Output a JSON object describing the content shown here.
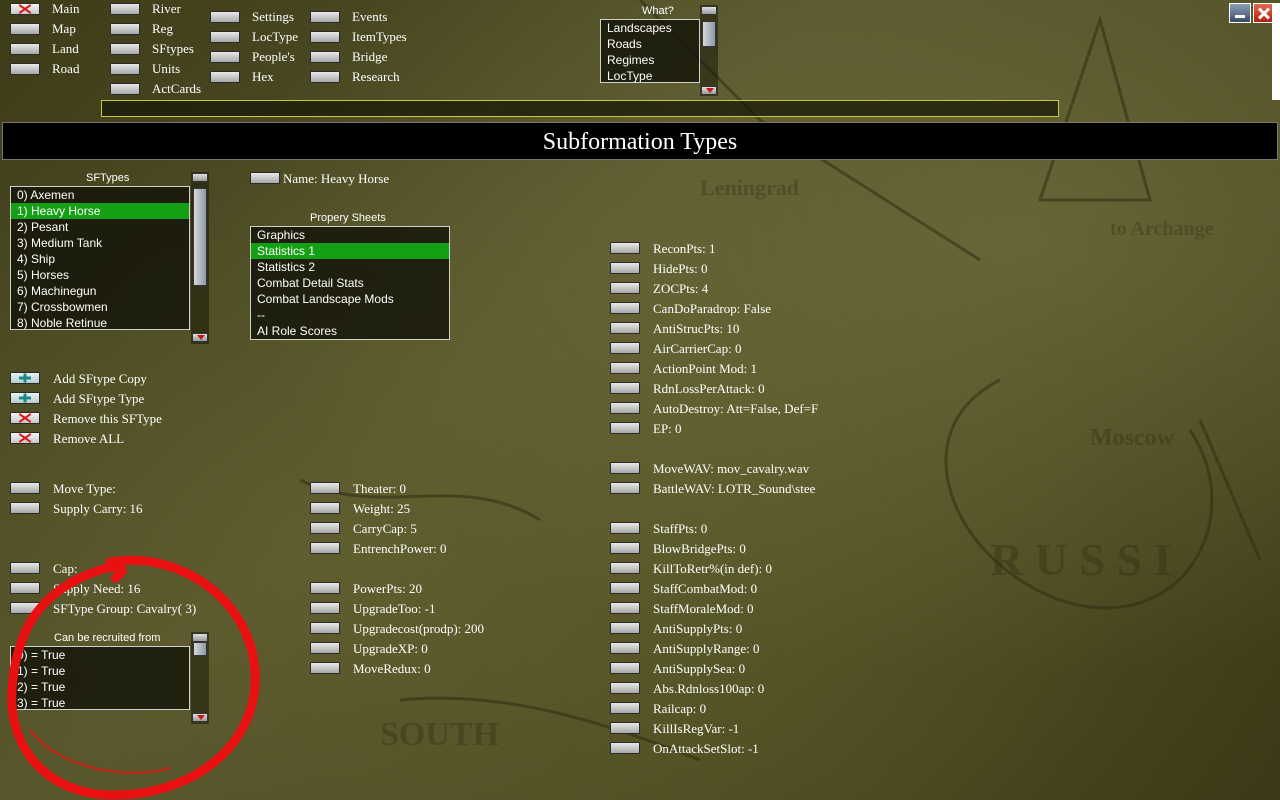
{
  "top_nav": {
    "col1": [
      "Main",
      "Map",
      "Land",
      "Road"
    ],
    "col2": [
      "River",
      "Reg",
      "SFtypes",
      "Units",
      "ActCards"
    ],
    "col3": [
      "Settings",
      "LocType",
      "People's",
      "Hex"
    ],
    "col4": [
      "Events",
      "ItemTypes",
      "Bridge",
      "Research"
    ]
  },
  "what": {
    "label": "What?",
    "items": [
      "Landscapes",
      "Roads",
      "Regimes",
      "LocType"
    ]
  },
  "page_title": "Subformation Types",
  "sftypes": {
    "label": "SFTypes",
    "items": [
      "0) Axemen",
      "1) Heavy Horse",
      "2) Pesant",
      "3) Medium Tank",
      "4) Ship",
      "5) Horses",
      "6) Machinegun",
      "7) Crossbowmen",
      "8) Noble Retinue"
    ],
    "selected_index": 1
  },
  "name_field": "Name: Heavy Horse",
  "property_sheets": {
    "label": "Propery Sheets",
    "items": [
      "Graphics",
      "Statistics 1",
      "Statistics 2",
      "Combat Detail Stats",
      "Combat Landscape Mods",
      "--",
      "AI Role Scores"
    ],
    "selected_index": 1
  },
  "actions": {
    "add_copy": "Add SFtype Copy",
    "add_type": "Add SFtype Type",
    "remove_this": "Remove this SFType",
    "remove_all": "Remove ALL"
  },
  "left_props": [
    "Move Type:",
    "Supply Carry:  16"
  ],
  "left_props2": [
    "Cap:",
    "Supply Need:  16",
    "SFType Group: Cavalry( 3)"
  ],
  "recruit": {
    "label": "Can be recruited from",
    "items": [
      "0)  = True",
      "1)  = True",
      "2)  = True",
      "3)  = True"
    ]
  },
  "mid_props1": [
    "Theater:  0",
    "Weight:  25",
    "CarryCap:  5",
    "EntrenchPower:  0"
  ],
  "mid_props2": [
    "PowerPts:  20",
    "UpgradeToo: -1",
    "Upgradecost(prodp):  200",
    "UpgradeXP:  0",
    "MoveRedux:  0"
  ],
  "right_props1": [
    "ReconPts:  1",
    "HidePts:  0",
    "ZOCPts:  4",
    "CanDoParadrop: False",
    "AntiStrucPts:  10",
    "AirCarrierCap:  0",
    "ActionPoint Mod:  1",
    "RdnLossPerAttack:  0",
    "AutoDestroy: Att=False, Def=F",
    "EP:  0"
  ],
  "right_props2": [
    "MoveWAV: mov_cavalry.wav",
    "BattleWAV:  LOTR_Sound\\stee"
  ],
  "right_props3": [
    "StaffPts:  0",
    "BlowBridgePts:  0",
    "KillToRetr%(in def):  0",
    "StaffCombatMod:  0",
    "StaffMoraleMod:  0",
    "AntiSupplyPts:  0",
    "AntiSupplyRange:  0",
    "AntiSupplySea:  0",
    "Abs.Rdnloss100ap:  0",
    "Railcap:  0",
    "KillIsRegVar:  -1",
    "OnAttackSetSlot:  -1"
  ],
  "annotation_color": "#e81010",
  "selection_color": "#14a014"
}
